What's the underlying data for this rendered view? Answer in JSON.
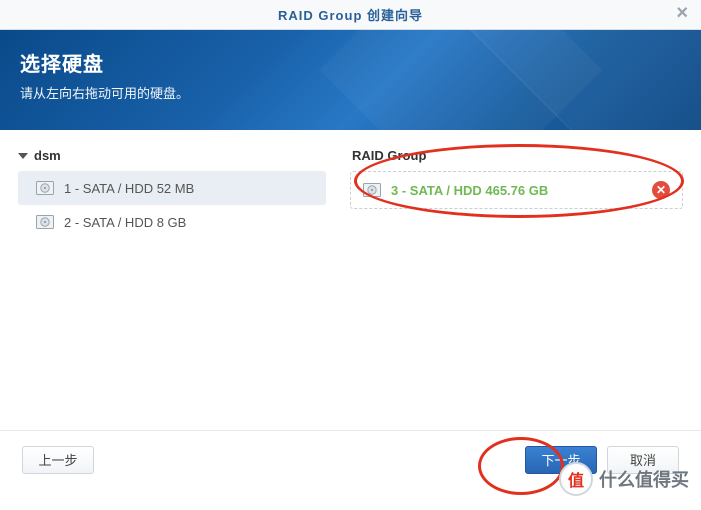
{
  "window": {
    "title": "RAID Group 创建向导"
  },
  "banner": {
    "heading": "选择硬盘",
    "sub": "请从左向右拖动可用的硬盘。"
  },
  "left": {
    "tree_label": "dsm",
    "disks": [
      {
        "label": "1 - SATA / HDD 52 MB"
      },
      {
        "label": "2 - SATA / HDD 8 GB"
      }
    ]
  },
  "right": {
    "panel_title": "RAID Group",
    "items": [
      {
        "label": "3 - SATA / HDD 465.76 GB"
      }
    ]
  },
  "footer": {
    "prev": "上一步",
    "next": "下一步",
    "cancel": "取消"
  },
  "watermark": {
    "badge": "值",
    "text": "什么值得买"
  }
}
